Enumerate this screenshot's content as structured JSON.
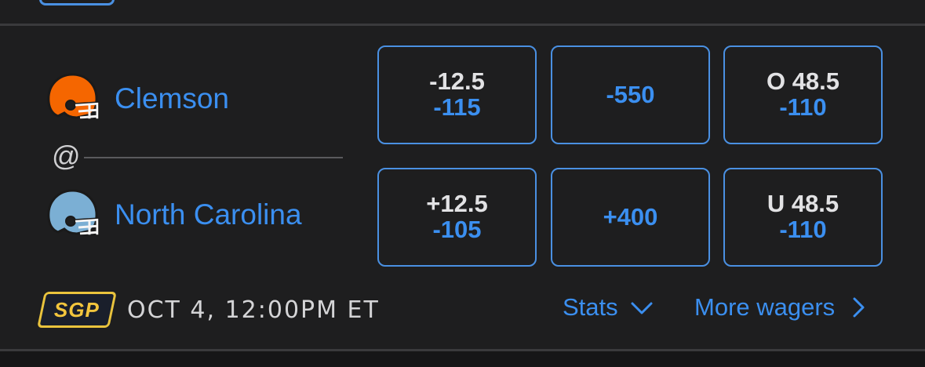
{
  "game": {
    "home_team": {
      "name": "Clemson",
      "helmet_icon": "helmet-icon",
      "helmet_color": "#f56600"
    },
    "away_team": {
      "name": "North Carolina",
      "helmet_icon": "helmet-icon",
      "helmet_color": "#7bafd4"
    },
    "separator": "@",
    "odds": {
      "home": {
        "spread_line": "-12.5",
        "spread_price": "-115",
        "moneyline": "-550",
        "total_line": "O 48.5",
        "total_price": "-110"
      },
      "away": {
        "spread_line": "+12.5",
        "spread_price": "-105",
        "moneyline": "+400",
        "total_line": "U 48.5",
        "total_price": "-110"
      }
    },
    "badge": "SGP",
    "start_time": "OCT 4, 12:00PM ET",
    "links": {
      "stats": "Stats",
      "stats_icon": "chevron-down-icon",
      "more_wagers": "More wagers",
      "more_wagers_icon": "chevron-right-icon"
    }
  },
  "colors": {
    "background": "#1e1e1f",
    "accent": "#3b8ff0",
    "button_border": "#4a90e2",
    "badge_gold": "#f2c53d"
  }
}
